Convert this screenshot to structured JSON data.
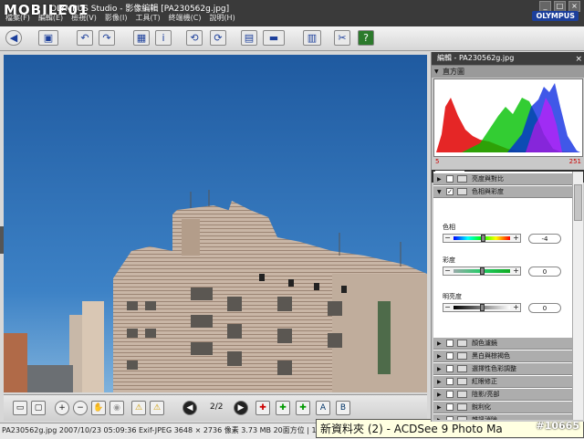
{
  "window": {
    "title": "OLYMPUS Studio - 影像編輯 [PA230562g.jpg]",
    "brand": "OLYMPUS",
    "controls": [
      "_",
      "□",
      "×"
    ]
  },
  "watermark": {
    "site": "MOBILE01",
    "id": "#10665"
  },
  "menu": [
    "檔案(F)",
    "編輯(E)",
    "檢視(V)",
    "影像(I)",
    "工具(T)",
    "終端機(C)",
    "說明(H)"
  ],
  "toolbar": {
    "icons": [
      "back-icon",
      "save-icon",
      "undo-icon",
      "redo-icon",
      "grid-icon",
      "info-icon",
      "rotate-left-icon",
      "rotate-right-icon",
      "compare-icon",
      "screen-icon",
      "batch-icon",
      "tools-icon",
      "help-icon"
    ]
  },
  "viewer": {
    "page_indicator": "2/2",
    "bottom_icons": [
      "fit-icon",
      "actual-size-icon",
      "zoom-in-icon",
      "zoom-out-icon",
      "hand-icon",
      "eye-icon",
      "warning-icon",
      "warning2-icon",
      "prev-icon",
      "next-icon",
      "add-icon",
      "add2-icon",
      "add3-icon",
      "a-icon",
      "b-icon"
    ]
  },
  "status": {
    "text": "PA230562g.jpg  2007/10/23 05:09:36  Exif-JPEG  3648 × 2736 像素  3.73 MB  20面方位  |  1711"
  },
  "taskbar": {
    "text": "新資料夾 (2) - ACDSee 9 Photo Ma"
  },
  "panel": {
    "title": "編輯 - PA230562g.jpg",
    "histogram_label": "直方圖",
    "histo_min": "5",
    "histo_max": "251",
    "tab": "編輯",
    "sections": [
      {
        "label": "亮度與對比",
        "checked": false,
        "expanded": false
      },
      {
        "label": "色相與彩度",
        "checked": true,
        "expanded": true
      }
    ],
    "params": [
      {
        "label": "色相",
        "value": "-4",
        "level": 0.52
      },
      {
        "label": "彩度",
        "value": "0",
        "level": 0.5
      },
      {
        "label": "明亮度",
        "value": "0",
        "level": 0.5
      }
    ],
    "more_items": [
      "顏色濾鏡",
      "黑白與棕褐色",
      "選擇性色彩調整",
      "紅眼修正",
      "陰影/亮部",
      "銳利化",
      "雜訊消除",
      "雜訊修正"
    ],
    "colors": {
      "histo_red": "#e00000",
      "histo_green": "#00c000",
      "histo_blue": "#0020e0",
      "panel_dark": "#3d3d3d"
    }
  }
}
